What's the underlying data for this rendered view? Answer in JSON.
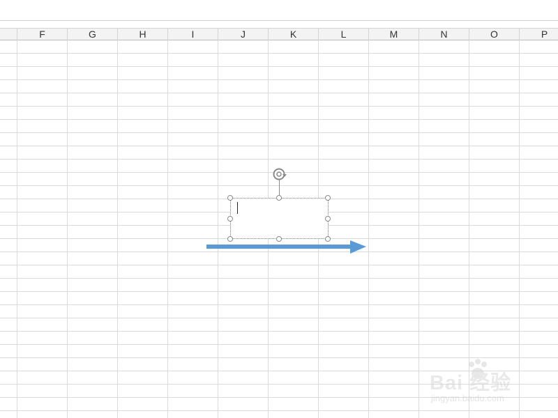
{
  "spreadsheet": {
    "columns": [
      "F",
      "G",
      "H",
      "I",
      "J",
      "K",
      "L",
      "M",
      "N",
      "O",
      "P"
    ]
  },
  "colors": {
    "arrow": "#5b9bd5",
    "gridline": "#dadada",
    "header_bg": "#f3f3f3",
    "handle_border": "#8a8a8a"
  },
  "shape": {
    "type": "text-box",
    "text": ""
  },
  "icons": {
    "rotate": "rotate-icon",
    "arrow": "right-arrow-shape"
  },
  "watermark": {
    "logo": "Bai 经验",
    "sub": "jingyan.baidu.com"
  }
}
